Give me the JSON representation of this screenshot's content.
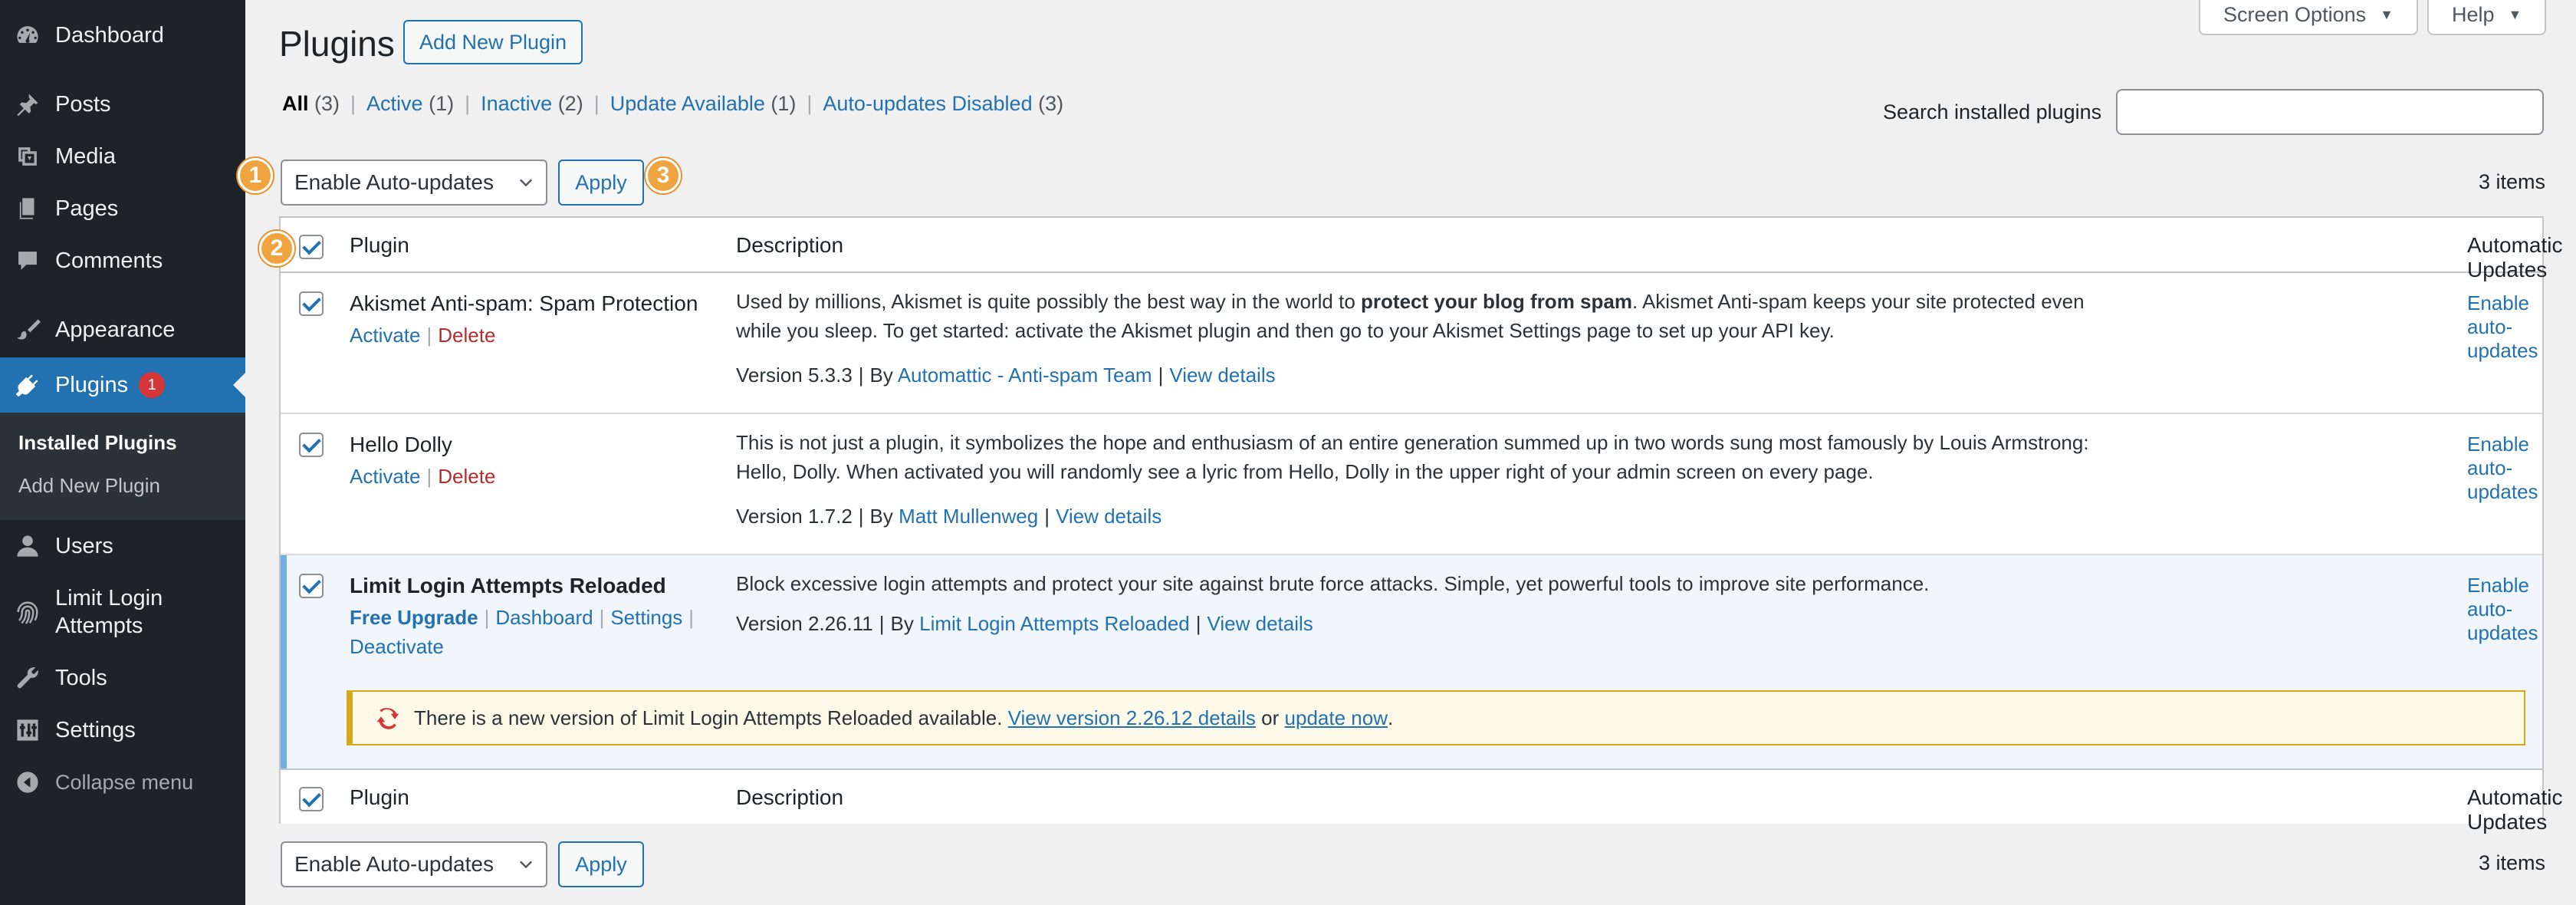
{
  "sidebar": {
    "items": [
      {
        "key": "dashboard",
        "label": "Dashboard",
        "icon": "dashboard-icon"
      },
      {
        "key": "posts",
        "label": "Posts",
        "icon": "pin-icon"
      },
      {
        "key": "media",
        "label": "Media",
        "icon": "media-icon"
      },
      {
        "key": "pages",
        "label": "Pages",
        "icon": "pages-icon"
      },
      {
        "key": "comments",
        "label": "Comments",
        "icon": "comment-icon"
      },
      {
        "key": "appearance",
        "label": "Appearance",
        "icon": "brush-icon"
      },
      {
        "key": "plugins",
        "label": "Plugins",
        "icon": "plugin-icon",
        "badge": "1"
      },
      {
        "key": "users",
        "label": "Users",
        "icon": "user-icon"
      },
      {
        "key": "limit-login",
        "label_line1": "Limit Login",
        "label_line2": "Attempts",
        "icon": "fingerprint-icon"
      },
      {
        "key": "tools",
        "label": "Tools",
        "icon": "wrench-icon"
      },
      {
        "key": "settings",
        "label": "Settings",
        "icon": "sliders-icon"
      },
      {
        "key": "collapse",
        "label": "Collapse menu",
        "icon": "collapse-icon"
      }
    ],
    "submenu": {
      "installed": "Installed Plugins",
      "add_new": "Add New Plugin"
    }
  },
  "header": {
    "title": "Plugins",
    "add_new": "Add New Plugin",
    "screen_options": "Screen Options",
    "help": "Help"
  },
  "filters": [
    {
      "label": "All",
      "count": "(3)"
    },
    {
      "label": "Active",
      "count": "(1)"
    },
    {
      "label": "Inactive",
      "count": "(2)"
    },
    {
      "label": "Update Available",
      "count": "(1)"
    },
    {
      "label": "Auto-updates Disabled",
      "count": "(3)"
    }
  ],
  "search": {
    "label": "Search installed plugins",
    "value": ""
  },
  "bulk": {
    "selected": "Enable Auto-updates",
    "apply": "Apply",
    "count": "3 items"
  },
  "steps": [
    "1",
    "2",
    "3"
  ],
  "table": {
    "columns": {
      "plugin": "Plugin",
      "description": "Description",
      "auto": "Automatic Updates"
    },
    "rows": [
      {
        "name": "Akismet Anti-spam: Spam Protection",
        "actions": [
          "Activate",
          "Delete"
        ],
        "desc_part1": "Used by millions, Akismet is quite possibly the best way in the world to ",
        "desc_bold": "protect your blog from spam",
        "desc_part2": ". Akismet Anti-spam keeps your site protected even while you sleep. To get started: activate the Akismet plugin and then go to your Akismet Settings page to set up your API key.",
        "version": "Version 5.3.3",
        "by": "By",
        "author": "Automattic - Anti-spam Team",
        "view_details": "View details",
        "auto_link": "Enable auto-updates"
      },
      {
        "name": "Hello Dolly",
        "actions": [
          "Activate",
          "Delete"
        ],
        "desc": "This is not just a plugin, it symbolizes the hope and enthusiasm of an entire generation summed up in two words sung most famously by Louis Armstrong: Hello, Dolly. When activated you will randomly see a lyric from Hello, Dolly in the upper right of your admin screen on every page.",
        "version": "Version 1.7.2",
        "by": "By",
        "author": "Matt Mullenweg",
        "view_details": "View details",
        "auto_link": "Enable auto-updates"
      },
      {
        "name": "Limit Login Attempts Reloaded",
        "actions": [
          "Free Upgrade",
          "Dashboard",
          "Settings",
          "Deactivate"
        ],
        "desc": "Block excessive login attempts and protect your site against brute force attacks. Simple, yet powerful tools to improve site performance.",
        "version": "Version 2.26.11",
        "by": "By",
        "author": "Limit Login Attempts Reloaded",
        "view_details": "View details",
        "auto_link": "Enable auto-updates",
        "notice": {
          "text1": "There is a new version of Limit Login Attempts Reloaded available.",
          "link1": "View version 2.26.12 details",
          "text2": "or",
          "link2": "update now",
          "text3": "."
        }
      }
    ]
  },
  "colors": {
    "sidebar_bg": "#1d2327",
    "accent": "#2271b1",
    "delete": "#b32d2e",
    "badge": "#d63638",
    "step_badge": "#f0a43f",
    "notice_bg": "#fcf9e8",
    "notice_border": "#dba617"
  }
}
